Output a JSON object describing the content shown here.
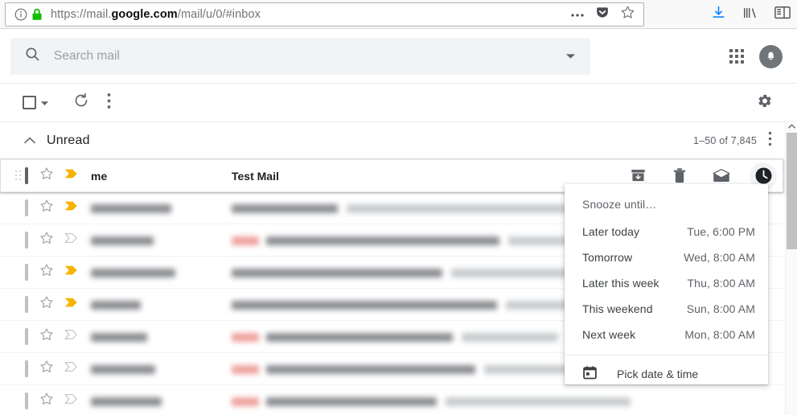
{
  "browser": {
    "url_prefix": "https://mail.",
    "url_domain": "google.com",
    "url_suffix": "/mail/u/0/#inbox",
    "url_full": "https://mail.google.com/mail/u/0/#inbox",
    "icons": {
      "info": "info-icon",
      "lock": "lock-icon",
      "page_actions": "ellipsis-icon",
      "pocket": "pocket-icon",
      "bookmark": "star-icon",
      "downloads": "download-arrow-icon",
      "library": "library-icon",
      "sidebar": "sidebar-icon"
    },
    "lock_color": "#12bc00",
    "download_color": "#0a84ff"
  },
  "search": {
    "placeholder": "Search mail",
    "icon": "search-icon",
    "caret_icon": "chevron-down-icon"
  },
  "header": {
    "apps_icon": "apps-grid-icon",
    "avatar_icon": "notification-bell-avatar"
  },
  "toolbar": {
    "select_all_checkbox": "select-all-checkbox",
    "select_caret": "chevron-down-icon",
    "refresh_icon": "refresh-icon",
    "more_icon": "more-vertical-icon",
    "settings_icon": "gear-icon"
  },
  "section": {
    "collapse_icon": "chevron-up-icon",
    "title": "Unread",
    "count": "1–50 of 7,845",
    "more_icon": "more-vertical-icon"
  },
  "rows": [
    {
      "sender": "me",
      "subject": "Test Mail",
      "hovered": true,
      "important": true,
      "star": "star-outline-icon",
      "redacted": false
    },
    {
      "sender": "",
      "subject": "",
      "hovered": false,
      "important": true,
      "star": "star-outline-icon",
      "redacted": true,
      "blur": {
        "sender_w": 100,
        "badge": false,
        "subj_w": 132,
        "snippet_w": 300
      }
    },
    {
      "sender": "",
      "subject": "",
      "hovered": false,
      "important": false,
      "star": "star-outline-icon",
      "redacted": true,
      "blur": {
        "sender_w": 78,
        "badge": true,
        "subj_w": 290,
        "snippet_w": 160
      }
    },
    {
      "sender": "",
      "subject": "",
      "hovered": false,
      "important": true,
      "star": "star-outline-icon",
      "redacted": true,
      "blur": {
        "sender_w": 105,
        "badge": false,
        "subj_w": 262,
        "snippet_w": 150
      }
    },
    {
      "sender": "",
      "subject": "",
      "hovered": false,
      "important": true,
      "star": "star-outline-icon",
      "redacted": true,
      "blur": {
        "sender_w": 62,
        "badge": false,
        "subj_w": 330,
        "snippet_w": 110
      }
    },
    {
      "sender": "",
      "subject": "",
      "hovered": false,
      "important": false,
      "star": "star-outline-icon",
      "redacted": true,
      "blur": {
        "sender_w": 70,
        "badge": true,
        "subj_w": 232,
        "snippet_w": 120
      }
    },
    {
      "sender": "",
      "subject": "",
      "hovered": false,
      "important": false,
      "star": "star-outline-icon",
      "redacted": true,
      "blur": {
        "sender_w": 80,
        "badge": true,
        "subj_w": 260,
        "snippet_w": 130
      }
    },
    {
      "sender": "",
      "subject": "",
      "hovered": false,
      "important": false,
      "star": "star-outline-icon",
      "redacted": true,
      "blur": {
        "sender_w": 88,
        "badge": true,
        "subj_w": 212,
        "snippet_w": 230
      }
    }
  ],
  "row_actions": {
    "archive": "archive-icon",
    "delete": "trash-icon",
    "mark_read": "mark-as-read-envelope-icon",
    "snooze": "snooze-clock-icon",
    "snooze_active": true
  },
  "snooze_menu": {
    "title": "Snooze until…",
    "items": [
      {
        "label": "Later today",
        "value": "Tue, 6:00 PM"
      },
      {
        "label": "Tomorrow",
        "value": "Wed, 8:00 AM"
      },
      {
        "label": "Later this week",
        "value": "Thu, 8:00 AM"
      },
      {
        "label": "This weekend",
        "value": "Sun, 8:00 AM"
      },
      {
        "label": "Next week",
        "value": "Mon, 8:00 AM"
      }
    ],
    "pick": {
      "label": "Pick date & time",
      "icon": "calendar-icon"
    }
  },
  "scrollbar": {
    "up_icon": "scroll-up-arrow-icon"
  },
  "colors": {
    "important_yellow": "#f4b400",
    "text_primary": "#202124",
    "text_secondary": "#5f6368",
    "divider": "#e8eaed"
  }
}
